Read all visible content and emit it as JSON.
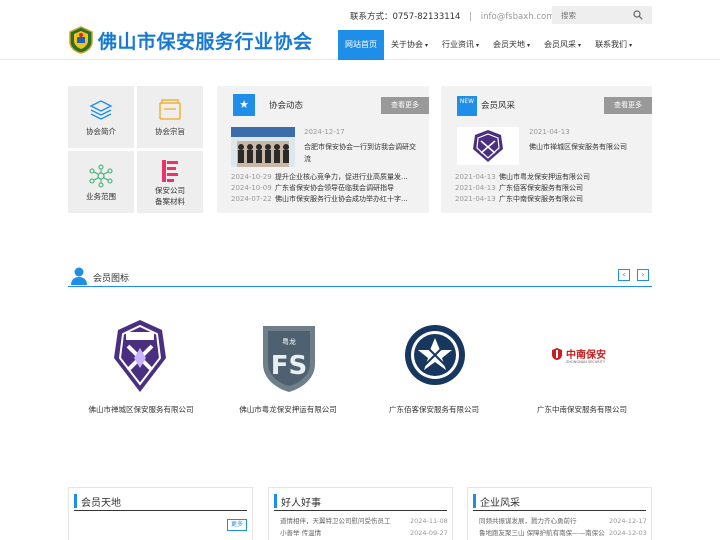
{
  "header": {
    "site_title": "佛山市保安服务行业协会",
    "contact": "联系方式：0757-82133114",
    "separator": "|",
    "email": "info@fsbaxh.com",
    "search_placeholder": "搜索"
  },
  "nav": [
    {
      "label": "网站首页",
      "active": true
    },
    {
      "label": "关于协会",
      "caret": "▾"
    },
    {
      "label": "行业资讯",
      "caret": "▾"
    },
    {
      "label": "会员天地",
      "caret": "▾"
    },
    {
      "label": "会员风采",
      "caret": "▾"
    },
    {
      "label": "联系我们",
      "caret": "▾"
    }
  ],
  "tiles": [
    {
      "label": "协会简介"
    },
    {
      "label": "协会宗旨"
    },
    {
      "label": "业务范围"
    },
    {
      "label_line1": "保安公司",
      "label_line2": "备案材料"
    }
  ],
  "association_news": {
    "badge": "★",
    "title": "协会动态",
    "more": "查看更多",
    "feature_date": "2024-12-17",
    "feature_text": "合肥市保安协会一行到访我会调研交流",
    "items": [
      {
        "date": "2024-10-29",
        "title": "提升企业核心竞争力，促进行业高质量发..."
      },
      {
        "date": "2024-10-09",
        "title": "广东省保安协会领导莅临我会调研指导"
      },
      {
        "date": "2024-07-22",
        "title": "佛山市保安服务行业协会成功举办红十字..."
      }
    ]
  },
  "member_style": {
    "badge": "NEW",
    "title": "会员风采",
    "more": "查看更多",
    "feature_date": "2021-04-13",
    "feature_text": "佛山市禅城区保安服务有限公司",
    "items": [
      {
        "date": "2021-04-13",
        "title": "佛山市粤龙保安押运有限公司"
      },
      {
        "date": "2021-04-13",
        "title": "广东佰客保安服务有限公司"
      },
      {
        "date": "2021-04-13",
        "title": "广东中南保安服务有限公司"
      }
    ]
  },
  "member_logos": {
    "title": "会员图标",
    "prev": "‹",
    "next": "›",
    "members": [
      {
        "name": "佛山市禅城区保安服务有限公司"
      },
      {
        "name": "佛山市粤龙保安押运有限公司",
        "logo_text": "粤龙"
      },
      {
        "name": "广东佰客保安服务有限公司"
      },
      {
        "name": "广东中南保安服务有限公司",
        "logo_text": "中南保安",
        "logo_sub": "ZHONGNAN SECURITY"
      }
    ]
  },
  "bottom": {
    "members_world": {
      "title": "会员天地",
      "more": "更多"
    },
    "good_people": {
      "title": "好人好事",
      "items": [
        {
          "title": "道情相伴，天翼特卫公司慰问受伤员工",
          "date": "2024-11-08"
        },
        {
          "title": "小善举 传温情",
          "date": "2024-09-27"
        }
      ]
    },
    "company_style": {
      "title": "企业风采",
      "items": [
        {
          "title": "同频共振谋发展，戮力齐心勇前行",
          "date": "2024-12-17"
        },
        {
          "title": "鲁地跑友聚三山 保障护航有南保——南保公",
          "date": "2024-12-03"
        }
      ]
    }
  },
  "colors": {
    "brand_blue": "#1f8ee8",
    "title_blue": "#1779d4",
    "panel_gray": "#f2f2f2",
    "tile_gray": "#eeeeee"
  }
}
